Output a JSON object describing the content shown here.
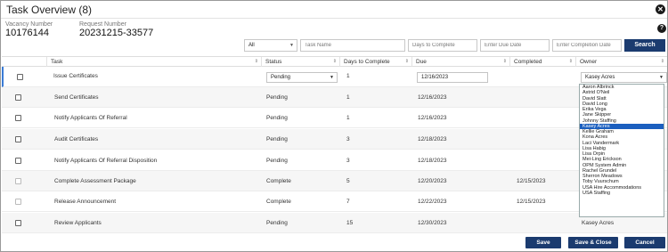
{
  "dialog": {
    "title": "Task Overview (8)",
    "vacancy_label": "Vacancy Number",
    "vacancy_value": "10176144",
    "request_label": "Request Number",
    "request_value": "20231215-33577"
  },
  "filters": {
    "status_selected": "All",
    "task_name_placeholder": "Task Name",
    "days_placeholder": "Days to Complete",
    "due_placeholder": "Enter Due Date",
    "completion_placeholder": "Enter Completion Date",
    "search_label": "Search"
  },
  "columns": [
    "Task",
    "Status",
    "Days to Complete",
    "Due",
    "Completed",
    "Owner"
  ],
  "rows": [
    {
      "task": "Issue Certificates",
      "status": "Pending",
      "days": "1",
      "due": "12/16/2023",
      "completed": "",
      "owner": "Kasey Acres",
      "editable": true
    },
    {
      "task": "Send Certificates",
      "status": "Pending",
      "days": "1",
      "due": "12/16/2023",
      "completed": "",
      "owner": ""
    },
    {
      "task": "Notify Applicants Of Referral",
      "status": "Pending",
      "days": "1",
      "due": "12/16/2023",
      "completed": "",
      "owner": ""
    },
    {
      "task": "Audit Certificates",
      "status": "Pending",
      "days": "3",
      "due": "12/18/2023",
      "completed": "",
      "owner": ""
    },
    {
      "task": "Notify Applicants Of Referral Disposition",
      "status": "Pending",
      "days": "3",
      "due": "12/18/2023",
      "completed": "",
      "owner": ""
    },
    {
      "task": "Complete Assessment Package",
      "status": "Complete",
      "days": "5",
      "due": "12/20/2023",
      "completed": "12/15/2023",
      "owner": ""
    },
    {
      "task": "Release Announcement",
      "status": "Complete",
      "days": "7",
      "due": "12/22/2023",
      "completed": "12/15/2023",
      "owner": ""
    },
    {
      "task": "Review Applicants",
      "status": "Pending",
      "days": "15",
      "due": "12/30/2023",
      "completed": "",
      "owner": "Kasey Acres"
    }
  ],
  "owner_options": [
    "Aaron Albrinck",
    "Astrid O'Neil",
    "David Slatt",
    "David Long",
    "Erika Vega",
    "Jane Skipper",
    "Johnny Staffing",
    "Kasey Acres",
    "Kellie Graham",
    "Kona Acres",
    "Laci Vandermark",
    "Lisa Habig",
    "Lisa Orpin",
    "Mei-Ling Erickson",
    "OPM System Admin",
    "Rachel Grundel",
    "Sherron Meadows",
    "Toby Vuurschum",
    "USA Hire Accommodations",
    "USA Staffing"
  ],
  "owner_selected": "Kasey Acres",
  "footer": {
    "save_label": "Save",
    "save_close_label": "Save & Close",
    "cancel_label": "Cancel"
  },
  "colors": {
    "primary_button": "#1b3b6f",
    "selected_option": "#1b5fbf"
  }
}
